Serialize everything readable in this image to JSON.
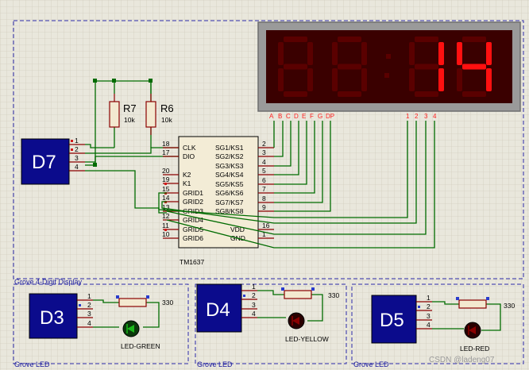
{
  "colors": {
    "background": "#e9e7dc",
    "wire": "#006b00",
    "module": "#0b0b8c",
    "segment_on": "#ff1010",
    "segment_off": "#5a0000"
  },
  "top_module": {
    "label": "D7",
    "pins": [
      "1",
      "2",
      "3",
      "4"
    ],
    "box_label": "Grove 4-Digit Display"
  },
  "resistors": [
    {
      "name": "R7",
      "value": "10k"
    },
    {
      "name": "R6",
      "value": "10k"
    }
  ],
  "ic": {
    "name": "TM1637",
    "left_pins": [
      {
        "num": "18",
        "name": "CLK"
      },
      {
        "num": "17",
        "name": "DIO"
      },
      {
        "num": "20",
        "name": "K2"
      },
      {
        "num": "19",
        "name": "K1"
      },
      {
        "num": "15",
        "name": "GRID1"
      },
      {
        "num": "14",
        "name": "GRID2"
      },
      {
        "num": "13",
        "name": "GRID3"
      },
      {
        "num": "12",
        "name": "GRID4"
      },
      {
        "num": "11",
        "name": "GRID5"
      },
      {
        "num": "10",
        "name": "GRID6"
      }
    ],
    "right_pins": [
      {
        "num": "2",
        "name": "SG1/KS1"
      },
      {
        "num": "3",
        "name": "SG2/KS2"
      },
      {
        "num": "4",
        "name": "SG3/KS3"
      },
      {
        "num": "5",
        "name": "SG4/KS4"
      },
      {
        "num": "6",
        "name": "SG5/KS5"
      },
      {
        "num": "7",
        "name": "SG6/KS6"
      },
      {
        "num": "8",
        "name": "SG7/KS7"
      },
      {
        "num": "9",
        "name": "SG8/KS8"
      },
      {
        "num": "16",
        "name": "VDD"
      },
      {
        "num": "1",
        "name": "GND"
      }
    ]
  },
  "display": {
    "digits": [
      "8",
      "8",
      "1",
      "4"
    ],
    "lit": [
      false,
      false,
      true,
      true
    ],
    "colon": true,
    "segment_labels": [
      "A",
      "B",
      "C",
      "D",
      "E",
      "F",
      "G",
      "DP"
    ],
    "digit_labels": [
      "1",
      "2",
      "3",
      "4"
    ]
  },
  "led_modules": [
    {
      "label": "D3",
      "resistor_value": "330",
      "led_name": "LED-GREEN",
      "led_color": "#1bb81b",
      "box_label": "Grove LED"
    },
    {
      "label": "D4",
      "resistor_value": "330",
      "led_name": "LED-YELLOW",
      "led_color": "#8a0000",
      "box_label": "Grove LED"
    },
    {
      "label": "D5",
      "resistor_value": "330",
      "led_name": "LED-RED",
      "led_color": "#8a0000",
      "box_label": "Grove LED"
    }
  ],
  "led_pins": [
    "1",
    "2",
    "3",
    "4"
  ],
  "watermark": "CSDN @ladeng07"
}
